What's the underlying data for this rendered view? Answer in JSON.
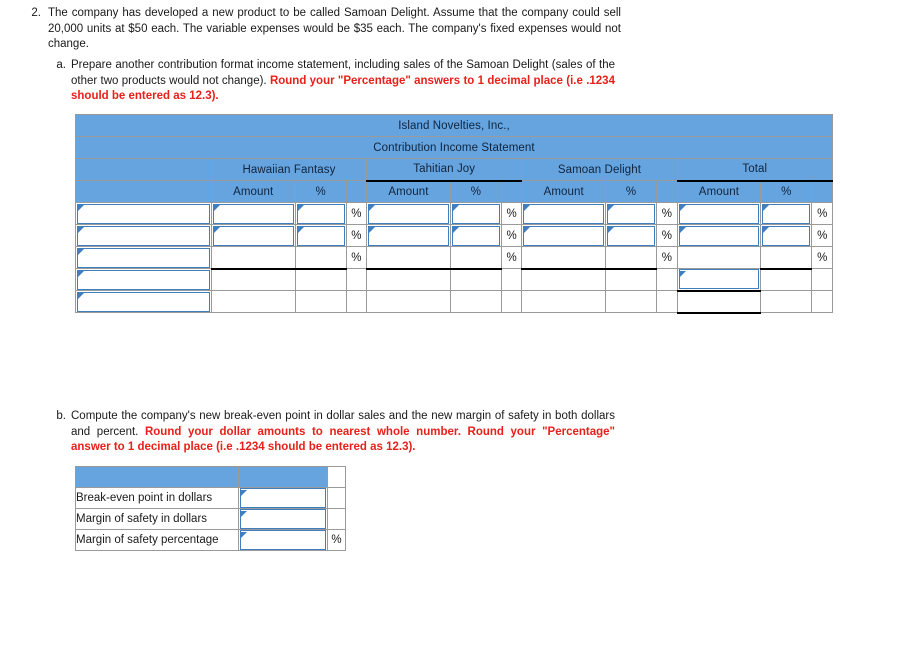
{
  "question_2": {
    "number": "2.",
    "line1": "The company has developed a new product to be called Samoan Delight. Assume that the company",
    "line2": "could sell 20,000 units at $50 each. The variable expenses would be $35 each. The company's fixed",
    "line3": "expenses would not change."
  },
  "part_a": {
    "number": "a.",
    "line1": "Prepare another contribution format income statement, including sales of the Samoan Delight (sales",
    "line2_plain": "of the other two products would not change). ",
    "line2_red": "Round your \"Percentage\" answers to 1 decimal",
    "line3_red": "place (i.e .1234 should be entered as 12.3)."
  },
  "part_b": {
    "number": "b.",
    "line1": "Compute the company's new break-even point in dollar sales and the new margin of safety in both",
    "line2_plain": "dollars and percent. ",
    "line2_red": "Round your dollar amounts to nearest whole number. Round your",
    "line3_red": "\"Percentage\" answer to 1 decimal place (i.e .1234 should be entered as 12.3)."
  },
  "main_sheet": {
    "company_title": "Island Novelties, Inc.,",
    "statement_title": "Contribution Income Statement",
    "product_headers": [
      "Hawaiian Fantasy",
      "Tahitian Joy",
      "Samoan Delight",
      "Total"
    ],
    "amount_label": "Amount",
    "percent_label": "%",
    "percent_symbol": "%",
    "rows": [
      {
        "label": "",
        "hf_amount": "",
        "hf_pct": "",
        "tj_amount": "",
        "tj_pct": "",
        "sd_amount": "",
        "sd_pct": "",
        "tot_amount": "",
        "tot_pct": ""
      },
      {
        "label": "",
        "hf_amount": "",
        "hf_pct": "",
        "tj_amount": "",
        "tj_pct": "",
        "sd_amount": "",
        "sd_pct": "",
        "tot_amount": "",
        "tot_pct": ""
      },
      {
        "label": "",
        "hf_amount": "",
        "hf_pct": "",
        "tj_amount": "",
        "tj_pct": "",
        "sd_amount": "",
        "sd_pct": "",
        "tot_amount": "",
        "tot_pct": ""
      },
      {
        "label": "",
        "tot_amount": ""
      },
      {
        "label": ""
      }
    ]
  },
  "sub_sheet": {
    "rows": [
      {
        "label": "Break-even point in dollars",
        "value": "",
        "suffix": ""
      },
      {
        "label": "Margin of safety in dollars",
        "value": "",
        "suffix": ""
      },
      {
        "label": "Margin of safety percentage",
        "value": "",
        "suffix": "%"
      }
    ]
  },
  "colors": {
    "header_blue": "#66a4e0",
    "input_border_blue": "#3f7fc0",
    "instruction_red": "#e8201a",
    "grid_gray": "#9a9a9a"
  }
}
